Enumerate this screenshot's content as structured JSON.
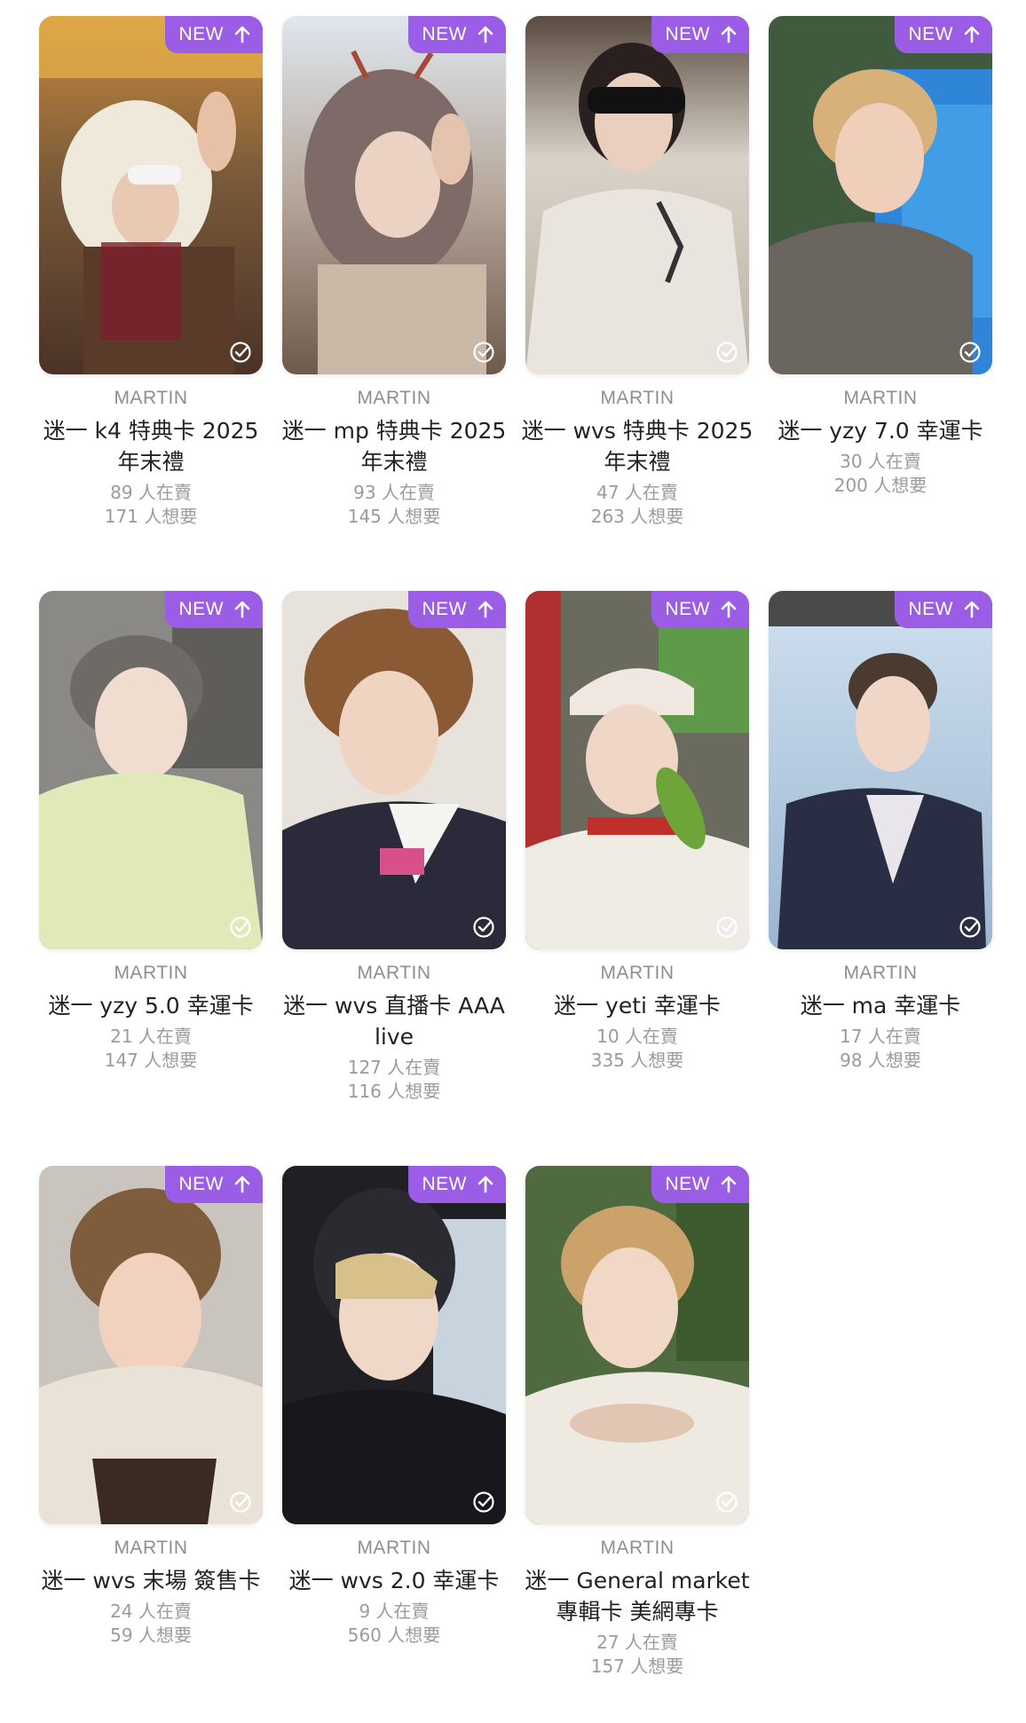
{
  "badge_label": "NEW",
  "accent_color": "#9b5de5",
  "cards": [
    {
      "artist": "MARTIN",
      "title": "迷一 k4 特典卡 2025年末禮",
      "sellers": "89 人在賣",
      "wants": "171 人想要"
    },
    {
      "artist": "MARTIN",
      "title": "迷一 mp 特典卡 2025年末禮",
      "sellers": "93 人在賣",
      "wants": "145 人想要"
    },
    {
      "artist": "MARTIN",
      "title": "迷一 wvs 特典卡 2025年末禮",
      "sellers": "47 人在賣",
      "wants": "263 人想要"
    },
    {
      "artist": "MARTIN",
      "title": "迷一 yzy 7.0 幸運卡",
      "sellers": "30 人在賣",
      "wants": "200 人想要"
    },
    {
      "artist": "MARTIN",
      "title": "迷一 yzy 5.0 幸運卡",
      "sellers": "21 人在賣",
      "wants": "147 人想要"
    },
    {
      "artist": "MARTIN",
      "title": "迷一 wvs 直播卡 AAA live",
      "sellers": "127 人在賣",
      "wants": "116 人想要"
    },
    {
      "artist": "MARTIN",
      "title": "迷一 yeti 幸運卡",
      "sellers": "10 人在賣",
      "wants": "335 人想要"
    },
    {
      "artist": "MARTIN",
      "title": "迷一 ma 幸運卡",
      "sellers": "17 人在賣",
      "wants": "98 人想要"
    },
    {
      "artist": "MARTIN",
      "title": "迷一 wvs 末場 簽售卡",
      "sellers": "24 人在賣",
      "wants": "59 人想要"
    },
    {
      "artist": "MARTIN",
      "title": "迷一 wvs 2.0 幸運卡",
      "sellers": "9 人在賣",
      "wants": "560 人想要"
    },
    {
      "artist": "MARTIN",
      "title": "迷一 General market 專輯卡 美網專卡",
      "sellers": "27 人在賣",
      "wants": "157 人想要"
    }
  ]
}
